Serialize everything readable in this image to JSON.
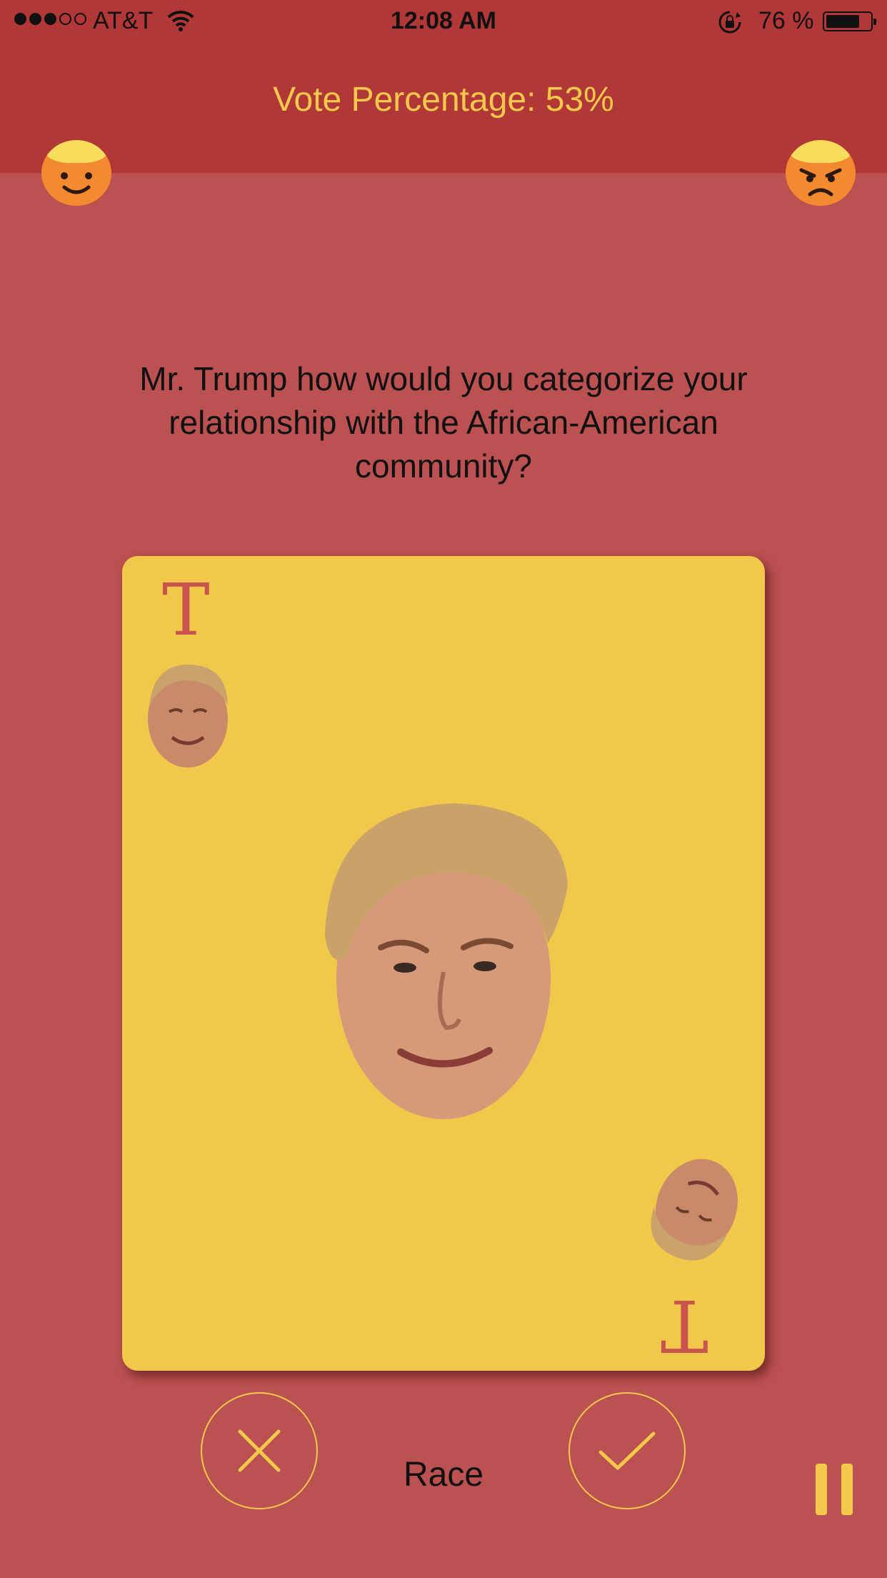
{
  "status_bar": {
    "carrier": "AT&T",
    "signal_bars_filled": 3,
    "signal_bars_total": 5,
    "time": "12:08 AM",
    "battery_percent": "76 %",
    "battery_level": 0.76
  },
  "header": {
    "vote_percentage": "Vote Percentage: 53%",
    "left_emoji": "happy-face-icon",
    "right_emoji": "angry-face-icon"
  },
  "question": {
    "lines": [
      "Mr. Trump how would you categorize your",
      "relationship with the African-American",
      "community?"
    ]
  },
  "card": {
    "corner_letter_top": "T",
    "corner_letter_bottom": "T",
    "background_color": "#f2c84a"
  },
  "controls": {
    "dismiss_icon": "x-icon",
    "approve_icon": "checkmark-icon",
    "category": "Race",
    "pause_icon": "pause-icon"
  },
  "colors": {
    "header_bg": "#b23737",
    "body_bg": "#bb5150",
    "accent": "#f3c84b"
  }
}
